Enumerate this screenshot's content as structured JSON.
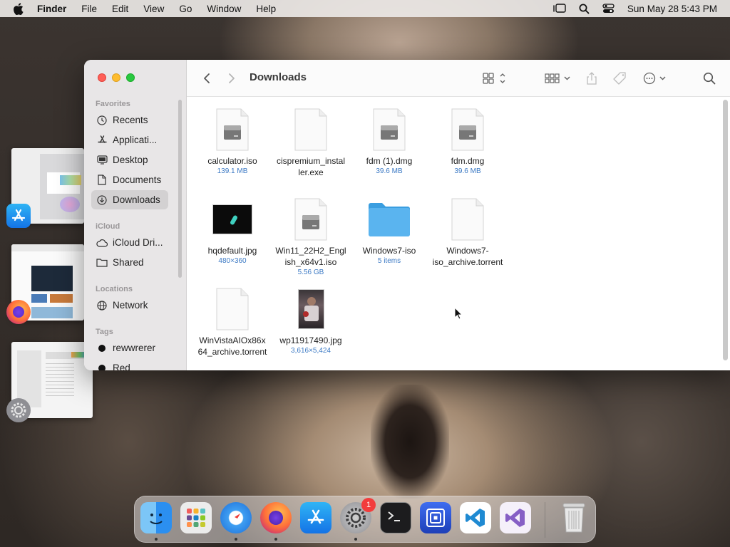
{
  "menubar": {
    "app_name": "Finder",
    "items": [
      "File",
      "Edit",
      "View",
      "Go",
      "Window",
      "Help"
    ],
    "clock": "Sun May 28  5:43 PM"
  },
  "window": {
    "folder_title": "Downloads"
  },
  "sidebar": {
    "favorites_heading": "Favorites",
    "favorites": [
      {
        "label": "Recents",
        "icon": "clock-icon"
      },
      {
        "label": "Applicati...",
        "icon": "applications-icon"
      },
      {
        "label": "Desktop",
        "icon": "desktop-icon"
      },
      {
        "label": "Documents",
        "icon": "document-icon"
      },
      {
        "label": "Downloads",
        "icon": "download-icon",
        "selected": true
      }
    ],
    "icloud_heading": "iCloud",
    "icloud": [
      {
        "label": "iCloud Dri...",
        "icon": "cloud-icon"
      },
      {
        "label": "Shared",
        "icon": "shared-folder-icon"
      }
    ],
    "locations_heading": "Locations",
    "locations": [
      {
        "label": "Network",
        "icon": "globe-icon"
      }
    ],
    "tags_heading": "Tags",
    "tags": [
      {
        "label": "rewwrerer",
        "color": "#111111"
      },
      {
        "label": "Red",
        "color": "#111111"
      }
    ]
  },
  "files": [
    {
      "name": "calculator.iso",
      "meta": "139.1 MB",
      "kind": "disk-image"
    },
    {
      "name": "cispremium_installer.exe",
      "meta": "",
      "kind": "blank-document"
    },
    {
      "name": "fdm (1).dmg",
      "meta": "39.6 MB",
      "kind": "disk-image"
    },
    {
      "name": "fdm.dmg",
      "meta": "39.6 MB",
      "kind": "disk-image"
    },
    {
      "name": "hqdefault.jpg",
      "meta": "480×360",
      "kind": "image-thumbnail"
    },
    {
      "name": "Win11_22H2_English_x64v1.iso",
      "meta": "5.56 GB",
      "kind": "disk-image"
    },
    {
      "name": "Windows7-iso",
      "meta": "5 items",
      "kind": "folder"
    },
    {
      "name": "Windows7-iso_archive.torrent",
      "meta": "",
      "kind": "blank-document"
    },
    {
      "name": "WinVistaAIOx86x64_archive.torrent",
      "meta": "",
      "kind": "blank-document"
    },
    {
      "name": "wp11917490.jpg",
      "meta": "3,616×5,424",
      "kind": "photo-thumbnail"
    }
  ],
  "dock": {
    "apps": [
      "Finder",
      "Launchpad",
      "Safari",
      "Firefox",
      "App Store",
      "System Settings",
      "Terminal",
      "Screen Sharing",
      "Visual Studio Code",
      "Visual Studio",
      "Trash"
    ],
    "settings_badge": "1"
  },
  "colors": {
    "accent_blue": "#3b79c4",
    "folder_blue": "#5ab4ef",
    "close": "#ff5f57",
    "minimize": "#febc2e",
    "zoom": "#28c840"
  }
}
